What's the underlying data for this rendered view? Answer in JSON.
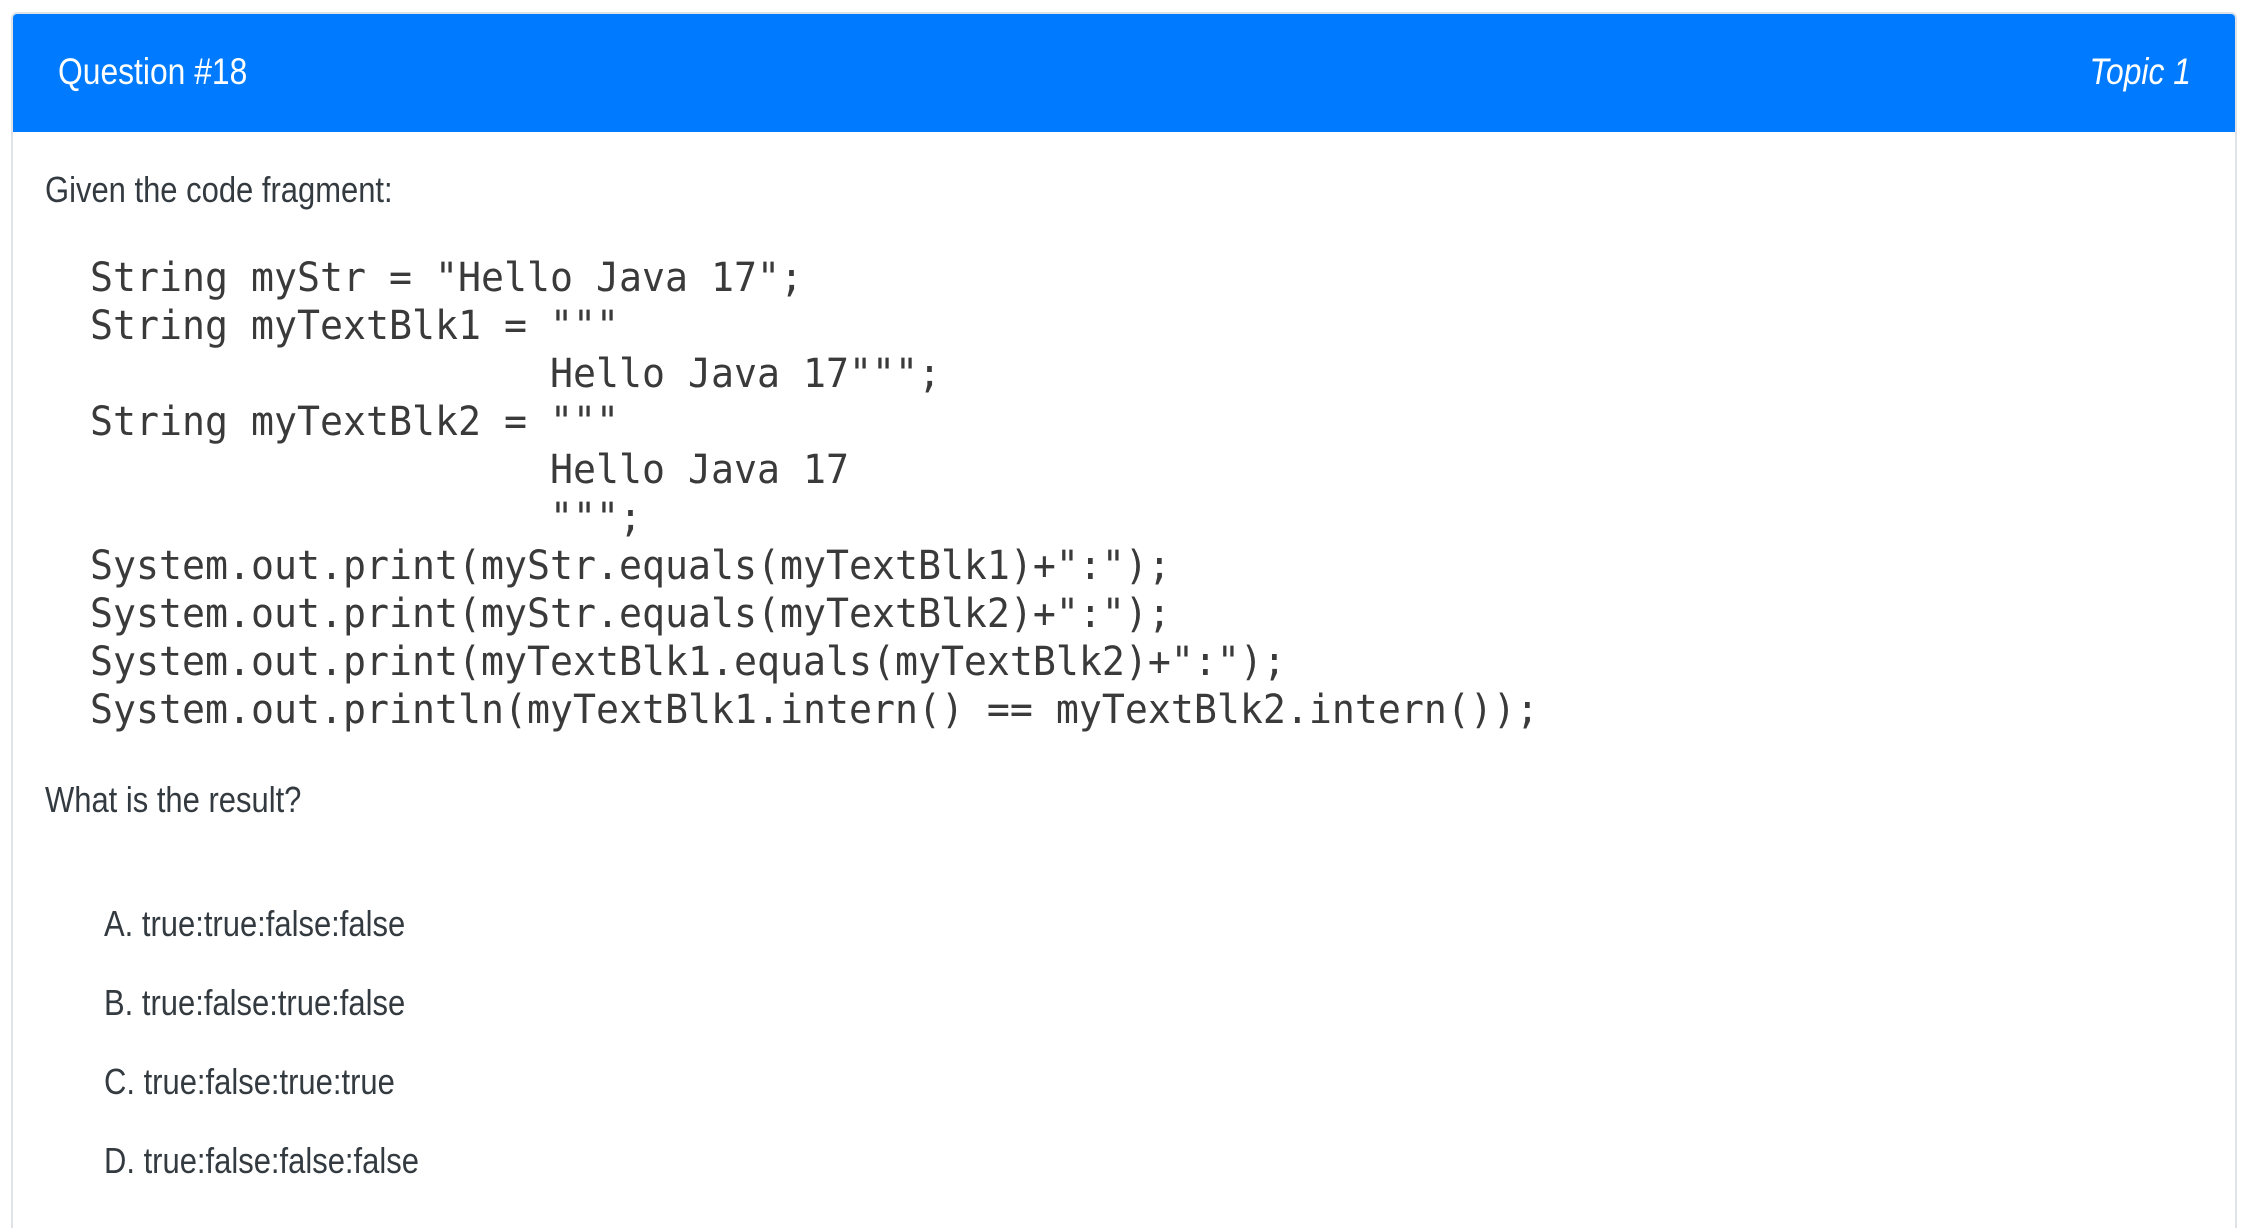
{
  "header": {
    "question_number": "Question #18",
    "topic": "Topic 1",
    "background_color": "#007bff"
  },
  "question": {
    "intro": "Given the code fragment:",
    "code": "String myStr = \"Hello Java 17\";\nString myTextBlk1 = \"\"\"\n                    Hello Java 17\"\"\";\nString myTextBlk2 = \"\"\"\n                    Hello Java 17\n                    \"\"\";\nSystem.out.print(myStr.equals(myTextBlk1)+\":\");\nSystem.out.print(myStr.equals(myTextBlk2)+\":\");\nSystem.out.print(myTextBlk1.equals(myTextBlk2)+\":\");\nSystem.out.println(myTextBlk1.intern() == myTextBlk2.intern());",
    "prompt": "What is the result?"
  },
  "choices": [
    {
      "letter": "A.",
      "text": "true:true:false:false"
    },
    {
      "letter": "B.",
      "text": "true:false:true:false"
    },
    {
      "letter": "C.",
      "text": "true:false:true:true"
    },
    {
      "letter": "D.",
      "text": "true:false:false:false"
    }
  ]
}
